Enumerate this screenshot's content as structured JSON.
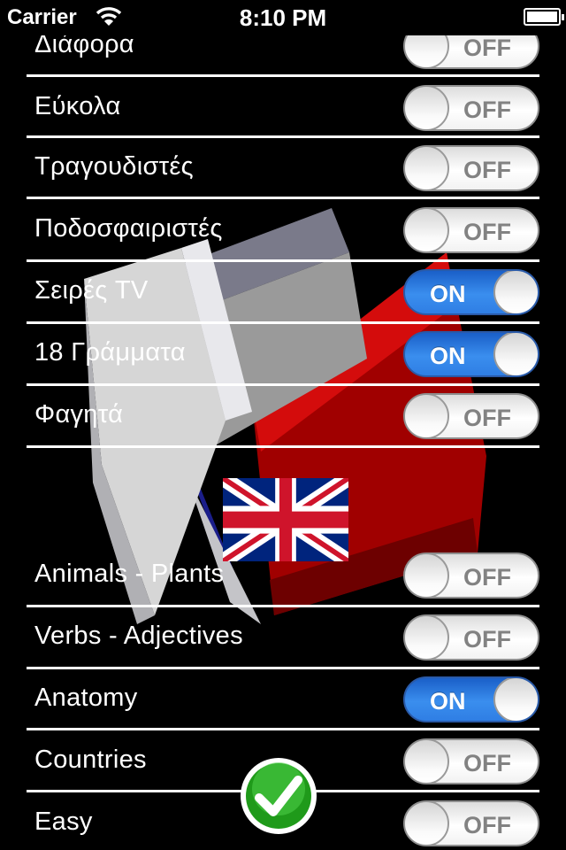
{
  "status_bar": {
    "carrier": "Carrier",
    "time": "8:10 PM"
  },
  "toggle_text": {
    "on": "ON",
    "off": "OFF"
  },
  "greek_categories": [
    {
      "label": "Διάφορα",
      "on": false
    },
    {
      "label": "Εύκολα",
      "on": false
    },
    {
      "label": "Τραγουδιστές",
      "on": false
    },
    {
      "label": "Ποδοσφαιριστές",
      "on": false
    },
    {
      "label": "Σειρές TV",
      "on": true
    },
    {
      "label": "18 Γράμματα",
      "on": true
    },
    {
      "label": "Φαγητά",
      "on": false
    }
  ],
  "english_categories": [
    {
      "label": "Animals - Plants",
      "on": false
    },
    {
      "label": "Verbs - Adjectives",
      "on": false
    },
    {
      "label": "Anatomy",
      "on": true
    },
    {
      "label": "Countries",
      "on": false
    },
    {
      "label": "Easy",
      "on": false
    }
  ],
  "colors": {
    "toggle_on": "#3a8eee",
    "toggle_off": "#ffffff",
    "done_green": "#1f9a1a"
  }
}
